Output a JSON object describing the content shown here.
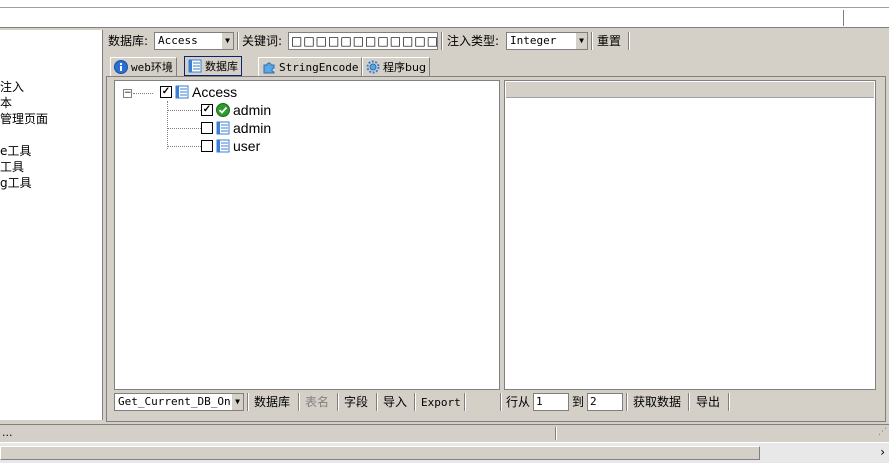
{
  "left_panel": {
    "items": [
      "注入",
      "本",
      "管理页面",
      "e工具",
      "工具",
      "g工具"
    ]
  },
  "toolbar": {
    "db_label": "数据库:",
    "db_value": "Access",
    "keyword_label": "关键词:",
    "keyword_value": "□□□□□□□□□□□□",
    "inject_label": "注入类型:",
    "inject_value": "Integer",
    "reset_label": "重置"
  },
  "tabs": [
    {
      "label": "web环境",
      "icon": "info-icon"
    },
    {
      "label": "数据库",
      "icon": "database-icon",
      "active": true
    },
    {
      "label": "StringEncode",
      "icon": "puzzle-icon"
    },
    {
      "label": "程序bug",
      "icon": "gear-icon"
    }
  ],
  "tree": {
    "root": {
      "label": "Access",
      "checked": true,
      "icon": "table-icon"
    },
    "children": [
      {
        "label": "admin",
        "checked": true,
        "icon": "check-circle-icon"
      },
      {
        "label": "admin",
        "checked": false,
        "icon": "table-icon"
      },
      {
        "label": "user",
        "checked": false,
        "icon": "table-icon"
      }
    ]
  },
  "bottom_left": {
    "function_value": "Get_Current_DB_Onl",
    "buttons": {
      "database": "数据库",
      "table_name": "表名",
      "field": "字段",
      "import": "导入",
      "export": "Export"
    }
  },
  "bottom_right": {
    "row_from_label": "行从",
    "row_from_value": "1",
    "to_label": "到",
    "to_value": "2",
    "fetch_label": "获取数据",
    "export_label": "导出"
  },
  "status": {
    "dots": "..."
  },
  "colors": {
    "background": "#d4d0c8",
    "accent_blue": "#0a246a",
    "check_green": "#2e9b2e",
    "table_blue": "#3a7fd5"
  }
}
